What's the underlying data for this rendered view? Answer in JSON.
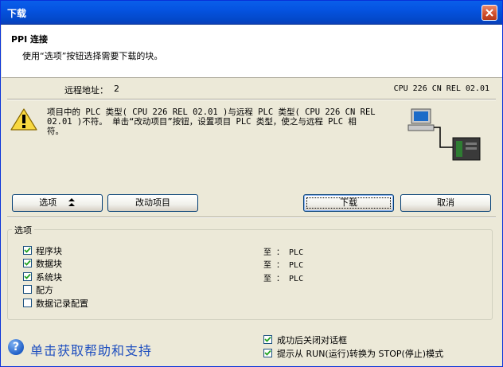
{
  "window": {
    "title": "下载"
  },
  "header": {
    "title": "PPI 连接",
    "subtitle": "使用“选项”按钮选择需要下载的块。"
  },
  "connection": {
    "remote_address_label": "远程地址：",
    "remote_address_value": "2",
    "remote_cpu": "CPU 226 CN REL 02.01"
  },
  "warning": {
    "line1": "项目中的 PLC 类型( CPU 226 REL 02.01 )与远程 PLC 类型( CPU 226 CN REL",
    "line2": "02.01 )不符。 单击“改动项目”按钮，设置项目 PLC 类型，使之与远程 PLC 相",
    "line3": "符。"
  },
  "buttons": {
    "options": "选项",
    "change_project": "改动项目",
    "download": "下载",
    "cancel": "取消"
  },
  "options_group": {
    "title": "选项",
    "items": [
      {
        "label": "程序块",
        "checked": true,
        "target": "至 ： PLC"
      },
      {
        "label": "数据块",
        "checked": true,
        "target": "至 ： PLC"
      },
      {
        "label": "系统块",
        "checked": true,
        "target": "至 ： PLC"
      },
      {
        "label": "配方",
        "checked": false,
        "target": ""
      },
      {
        "label": "数据记录配置",
        "checked": false,
        "target": ""
      }
    ]
  },
  "footer": {
    "help_text": "单击获取帮助和支持",
    "close_on_success": {
      "label": "成功后关闭对话框",
      "checked": true
    },
    "prompt_stop": {
      "label": "提示从 RUN(运行)转换为 STOP(停止)模式",
      "checked": true
    }
  }
}
